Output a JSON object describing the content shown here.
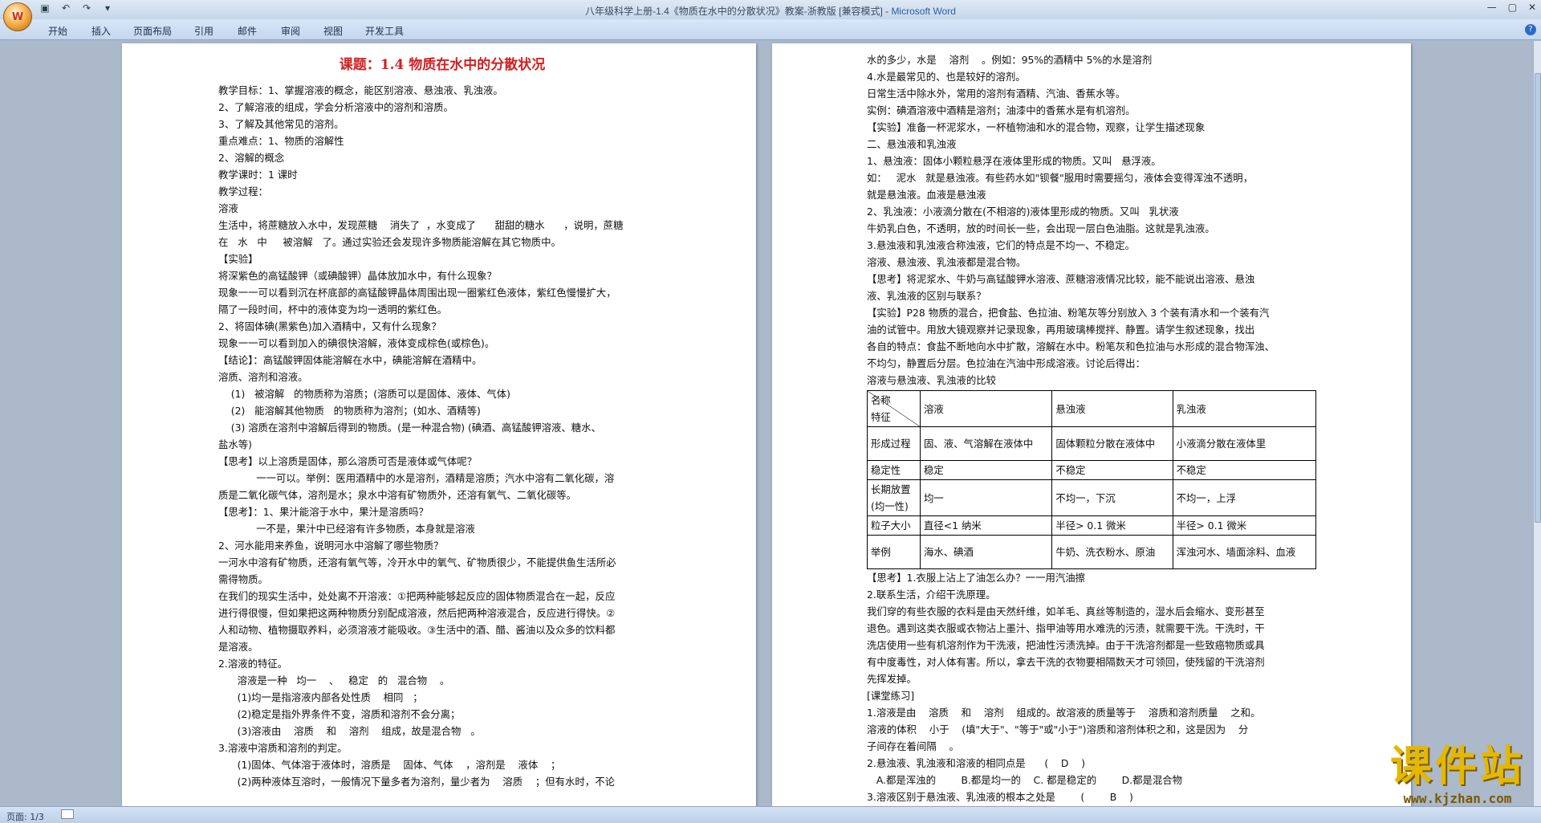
{
  "window": {
    "title": "八年级科学上册-1.4《物质在水中的分散状况》教案-浙教版 [兼容模式] - ",
    "app": "Microsoft Word",
    "office_button": "W"
  },
  "qat": {
    "save_icon": "save-icon",
    "undo_icon": "undo-icon",
    "redo_icon": "redo-icon",
    "customize_icon": "chevron-down-icon"
  },
  "ribbon_tabs": [
    "开始",
    "插入",
    "页面布局",
    "引用",
    "邮件",
    "审阅",
    "视图",
    "开发工具"
  ],
  "page1": {
    "title": "课题：1.4 物质在水中的分散状况",
    "lines": [
      "教学目标：1、掌握溶液的概念，能区别溶液、悬浊液、乳浊液。",
      "2、了解溶液的组成，学会分析溶液中的溶剂和溶质。",
      "3、了解及其他常见的溶剂。",
      "重点难点：1、物质的溶解性",
      "2、溶解的概念",
      "教学课时：1 课时",
      "教学过程：",
      "溶液",
      "生活中，将蔗糖放入水中，发现蔗糖    消失了  ，水变成了      甜甜的糖水      ，说明，蔗糖",
      "在   水   中     被溶解   了。通过实验还会发现许多物质能溶解在其它物质中。",
      "【实验】",
      "将深紫色的高锰酸钾（或碘酸钾）晶体放加水中，有什么现象？",
      "现象一一可以看到沉在杯底部的高锰酸钾晶体周围出现一圈紫红色液体，紫红色慢慢扩大，",
      "隔了一段时间，杯中的液体变为均一透明的紫红色。",
      "2、将固体碘(黑紫色)加入酒精中，又有什么现象？",
      "现象一一可以看到加入的碘很快溶解，液体变成棕色(或棕色)。",
      "【结论】：高锰酸钾固体能溶解在水中，碘能溶解在酒精中。",
      "溶质、溶剂和溶液。",
      "    (1)   被溶解   的物质称为溶质；(溶质可以是固体、液体、气体)",
      "    (2)   能溶解其他物质   的物质称为溶剂；(如水、酒精等)",
      "    (3) 溶质在溶剂中溶解后得到的物质。(是一种混合物) (碘酒、高锰酸钾溶液、糖水、",
      "盐水等)",
      "【思考】以上溶质是固体，那么溶质可否是液体或气体呢？",
      "            一一可以。举例：医用酒精中的水是溶剂，酒精是溶质；汽水中溶有二氧化碳，溶",
      "质是二氧化碳气体，溶剂是水；泉水中溶有矿物质外，还溶有氧气、二氧化碳等。",
      "【思考】：1、果汁能溶于水中，果汁是溶质吗？",
      "            一不是，果汁中已经溶有许多物质，本身就是溶液",
      "2、河水能用来养鱼，说明河水中溶解了哪些物质？",
      "一河水中溶有矿物质，还溶有氧气等，冷开水中的氧气、矿物质很少，不能提供鱼生活所必",
      "需得物质。",
      "在我们的现实生活中，处处离不开溶液：①把两种能够起反应的固体物质混合在一起，反应",
      "进行得很慢，但如果把这两种物质分别配成溶液，然后把两种溶液混合，反应进行得快。②",
      "人和动物、植物摄取养料，必须溶液才能吸收。③生活中的酒、醋、酱油以及众多的饮料都",
      "是溶液。",
      "2.溶液的特征。",
      "      溶液是一种   均一    、   稳定   的   混合物    。",
      "      (1)均一是指溶液内部各处性质    相同   ；",
      "      (2)稳定是指外界条件不变，溶质和溶剂不会分离；",
      "      (3)溶液由    溶质    和    溶剂    组成，故是混合物   。",
      "3.溶液中溶质和溶剂的判定。",
      "      (1)固体、气体溶于液体时，溶质是    固体、气体    ，溶剂是    液体    ；",
      "      (2)两种液体互溶时，一般情况下量多者为溶剂，量少者为    溶质    ；但有水时，不论"
    ]
  },
  "page2": {
    "lines_top": [
      "水的多少，水是    溶剂    。例如：95%的酒精中 5%的水是溶剂",
      "4.水是最常见的、也是较好的溶剂。",
      "日常生活中除水外，常用的溶剂有酒精、汽油、香蕉水等。",
      "实例：碘酒溶液中酒精是溶剂；油漆中的香蕉水是有机溶剂。",
      "【实验】准备一杯泥浆水，一杯植物油和水的混合物，观察，让学生描述现象",
      "二、悬浊液和乳浊液",
      "1、悬浊液：固体小颗粒悬浮在液体里形成的物质。又叫   悬浮液。",
      "如：   泥水   就是悬浊液。有些药水如\"钡餐\"服用时需要摇匀，液体会变得浑浊不透明，",
      "就是悬浊液。血液是悬浊液",
      "2、乳浊液：小液滴分散在(不相溶的)液体里形成的物质。又叫   乳状液",
      "牛奶乳白色，不透明，放的时间长一些，会出现一层白色油脂。这就是乳浊液。",
      "3.悬浊液和乳浊液合称浊液，它们的特点是不均一、不稳定。",
      "溶液、悬浊液、乳浊液都是混合物。",
      "【思考】将泥浆水、牛奶与高锰酸钾水溶液、蔗糖溶液情况比较，能不能说出溶液、悬浊",
      "液、乳浊液的区别与联系？",
      "【实验】P28 物质的混合，把食盐、色拉油、粉笔灰等分别放入 3 个装有清水和一个装有汽",
      "油的试管中。用放大镜观察并记录现象，再用玻璃棒搅拌、静置。请学生叙述现象，找出",
      "各自的特点：食盐不断地向水中扩散，溶解在水中。粉笔灰和色拉油与水形成的混合物浑浊、",
      "不均匀，静置后分层。色拉油在汽油中形成溶液。讨论后得出：",
      "溶液与悬浊液、乳浊液的比较"
    ],
    "table": {
      "header_corner_top": "名称",
      "header_corner_bottom": "特征",
      "headers": [
        "溶液",
        "悬浊液",
        "乳浊液"
      ],
      "rows": [
        {
          "label": "形成过程",
          "cells": [
            "固、液、气溶解在液体中",
            "固体颗粒分散在液体中",
            "小液滴分散在液体里"
          ]
        },
        {
          "label": "稳定性",
          "cells": [
            "稳定",
            "不稳定",
            "不稳定"
          ]
        },
        {
          "label": "长期放置(均一性)",
          "cells": [
            "均一",
            "不均一，下沉",
            "不均一，上浮"
          ]
        },
        {
          "label": "粒子大小",
          "cells": [
            "直径<1 纳米",
            "半径> 0.1 微米",
            "半径> 0.1 微米"
          ]
        },
        {
          "label": "举例",
          "cells": [
            "海水、碘酒",
            "牛奶、洗衣粉水、原油",
            "浑浊河水、墙面涂料、血液"
          ]
        }
      ]
    },
    "lines_bottom": [
      "【思考】1.衣服上沾上了油怎么办？一一用汽油擦",
      "2.联系生活，介绍干洗原理。",
      "我们穿的有些衣服的衣料是由天然纤维，如羊毛、真丝等制造的，湿水后会缩水、变形甚至",
      "退色。遇到这类衣服或衣物沾上墨汁、指甲油等用水难洗的污渍，就需要干洗。干洗时，干",
      "洗店使用一些有机溶剂作为干洗液，把油性污渍洗掉。由于干洗溶剂都是一些致癌物质或具",
      "有中度毒性，对人体有害。所以，拿去干洗的衣物要相隔数天才可领回，使残留的干洗溶剂",
      "先挥发掉。",
      "[课堂练习]",
      "1.溶液是由    溶质    和    溶剂    组成的。故溶液的质量等于    溶质和溶剂质量    之和。",
      "溶液的体积    小于    (填\"大于\"、\"等于\"或\"小于\")溶质和溶剂体积之和，这是因为    分",
      "子间存在着间隔    。",
      "2.悬浊液、乳浊液和溶液的相同点是      (    D    )",
      "   A.都是浑浊的        B.都是均一的    C. 都是稳定的        D.都是混合物",
      "3.溶液区别于悬浊液、乳浊液的根本之处是        (        B    )"
    ]
  },
  "status": {
    "page": "页面: 1/3"
  },
  "watermark": {
    "text": "课件站",
    "url": "www.kjzhan.com"
  },
  "help_icon": "?"
}
